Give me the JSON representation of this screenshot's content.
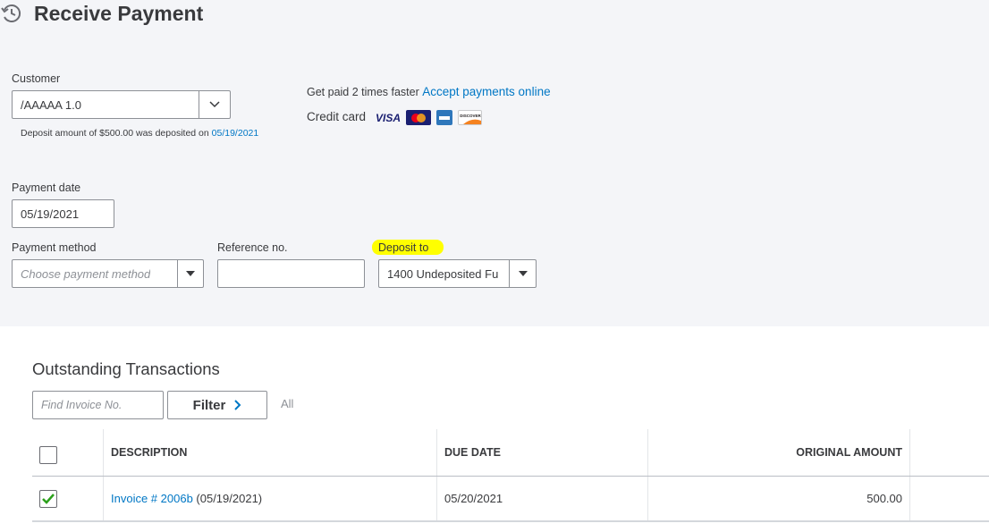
{
  "page": {
    "title": "Receive Payment"
  },
  "customer": {
    "label": "Customer",
    "value": "/AAAAA 1.0",
    "deposit_note": "Deposit amount of $500.00 was deposited on ",
    "deposit_date": "05/19/2021"
  },
  "promo": {
    "text": "Get paid 2 times faster",
    "link": "Accept payments online",
    "credit_label": "Credit card",
    "cards": [
      "VISA",
      "MasterCard",
      "AMEX",
      "DISCOVER"
    ]
  },
  "payment_date": {
    "label": "Payment date",
    "value": "05/19/2021"
  },
  "payment_method": {
    "label": "Payment method",
    "placeholder": "Choose payment method"
  },
  "reference": {
    "label": "Reference no.",
    "value": ""
  },
  "deposit_to": {
    "label": "Deposit to",
    "value": "1400 Undeposited Fu",
    "highlight_color": "#ffff00"
  },
  "outstanding": {
    "title": "Outstanding Transactions",
    "find_placeholder": "Find Invoice No.",
    "filter_label": "Filter",
    "all_label": "All",
    "columns": [
      "DESCRIPTION",
      "DUE DATE",
      "ORIGINAL AMOUNT"
    ],
    "rows": [
      {
        "checked": true,
        "invoice_link": "Invoice # 2006b",
        "invoice_date": " (05/19/2021)",
        "due_date": "05/20/2021",
        "amount": "500.00"
      }
    ]
  },
  "colors": {
    "accent": "#0077c5",
    "check": "#2ca01c",
    "background": "#f4f5f8"
  }
}
